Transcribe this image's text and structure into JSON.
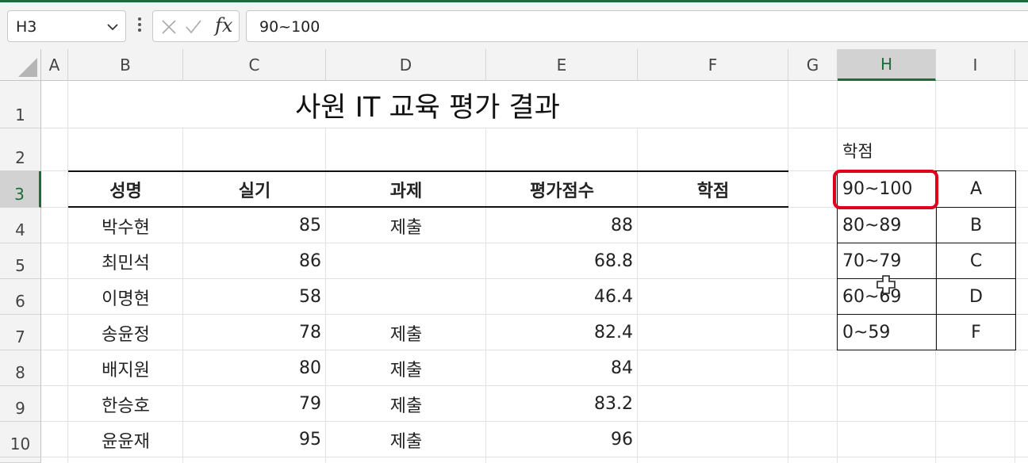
{
  "formula_bar": {
    "name_box": "H3",
    "formula": "90~100"
  },
  "columns": [
    "A",
    "B",
    "C",
    "D",
    "E",
    "F",
    "G",
    "H",
    "I"
  ],
  "rows": [
    "1",
    "2",
    "3",
    "4",
    "5",
    "6",
    "7",
    "8",
    "9",
    "10"
  ],
  "sheet": {
    "title": "사원 IT 교육 평가 결과",
    "headers": [
      "성명",
      "실기",
      "과제",
      "평가점수",
      "학점"
    ],
    "records": [
      [
        "박수현",
        "85",
        "제출",
        "88"
      ],
      [
        "최민석",
        "86",
        "",
        "68.8"
      ],
      [
        "이명현",
        "58",
        "",
        "46.4"
      ],
      [
        "송윤정",
        "78",
        "제출",
        "82.4"
      ],
      [
        "배지원",
        "80",
        "제출",
        "84"
      ],
      [
        "한승호",
        "79",
        "제출",
        "83.2"
      ],
      [
        "윤윤재",
        "95",
        "제출",
        "96"
      ]
    ]
  },
  "grade_table": {
    "label": "학점",
    "rows": [
      [
        "90~100",
        "A"
      ],
      [
        "80~89",
        "B"
      ],
      [
        "70~79",
        "C"
      ],
      [
        "60~69",
        "D"
      ],
      [
        "0~59",
        "F"
      ]
    ]
  },
  "colors": {
    "accent": "#1e6b3c",
    "highlight": "#e0001b"
  },
  "icons": [
    "chevron-down-icon",
    "more-vertical-icon",
    "cancel-icon",
    "enter-check-icon",
    "function-icon",
    "cell-cursor-icon",
    "select-all-icon"
  ]
}
